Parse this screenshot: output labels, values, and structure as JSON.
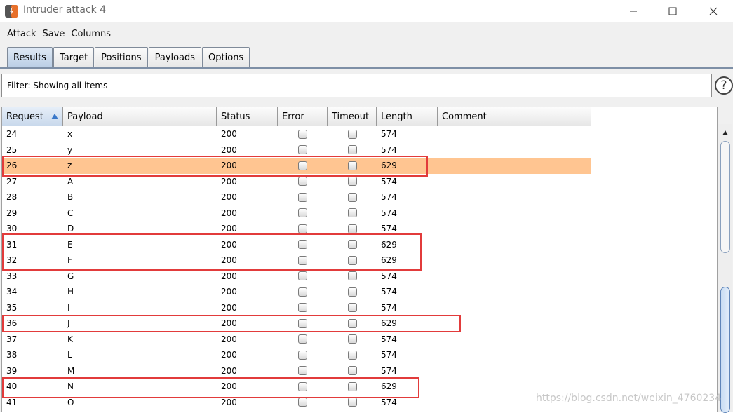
{
  "window": {
    "title": "Intruder attack 4"
  },
  "menu": [
    "Attack",
    "Save",
    "Columns"
  ],
  "tabs": [
    {
      "label": "Results",
      "active": true
    },
    {
      "label": "Target",
      "active": false
    },
    {
      "label": "Positions",
      "active": false
    },
    {
      "label": "Payloads",
      "active": false
    },
    {
      "label": "Options",
      "active": false
    }
  ],
  "filter": {
    "text": "Filter: Showing all items"
  },
  "table": {
    "columns": [
      "Request",
      "Payload",
      "Status",
      "Error",
      "Timeout",
      "Length",
      "Comment"
    ],
    "sorted_column": "Request",
    "rows": [
      {
        "request": "24",
        "payload": "x",
        "status": "200",
        "length": "574"
      },
      {
        "request": "25",
        "payload": "y",
        "status": "200",
        "length": "574"
      },
      {
        "request": "26",
        "payload": "z",
        "status": "200",
        "length": "629"
      },
      {
        "request": "27",
        "payload": "A",
        "status": "200",
        "length": "574"
      },
      {
        "request": "28",
        "payload": "B",
        "status": "200",
        "length": "574"
      },
      {
        "request": "29",
        "payload": "C",
        "status": "200",
        "length": "574"
      },
      {
        "request": "30",
        "payload": "D",
        "status": "200",
        "length": "574"
      },
      {
        "request": "31",
        "payload": "E",
        "status": "200",
        "length": "629"
      },
      {
        "request": "32",
        "payload": "F",
        "status": "200",
        "length": "629"
      },
      {
        "request": "33",
        "payload": "G",
        "status": "200",
        "length": "574"
      },
      {
        "request": "34",
        "payload": "H",
        "status": "200",
        "length": "574"
      },
      {
        "request": "35",
        "payload": "I",
        "status": "200",
        "length": "574"
      },
      {
        "request": "36",
        "payload": "J",
        "status": "200",
        "length": "629"
      },
      {
        "request": "37",
        "payload": "K",
        "status": "200",
        "length": "574"
      },
      {
        "request": "38",
        "payload": "L",
        "status": "200",
        "length": "574"
      },
      {
        "request": "39",
        "payload": "M",
        "status": "200",
        "length": "574"
      },
      {
        "request": "40",
        "payload": "N",
        "status": "200",
        "length": "629"
      },
      {
        "request": "41",
        "payload": "O",
        "status": "200",
        "length": "574"
      }
    ],
    "highlighted_request": "26",
    "highlight_color": "#ffc591"
  },
  "annotations": {
    "color": "#e23b3b"
  },
  "watermark": "https://blog.csdn.net/weixin_4760234"
}
